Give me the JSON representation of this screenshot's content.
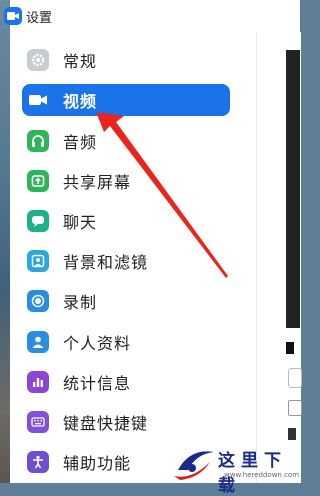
{
  "window": {
    "title": "设置"
  },
  "sidebar": {
    "items": [
      {
        "label": "常规",
        "icon": "gear-icon",
        "color": "#c9ccd1"
      },
      {
        "label": "视频",
        "icon": "video-camera-icon",
        "color": "#1a73e8",
        "selected": true
      },
      {
        "label": "音频",
        "icon": "headphones-icon",
        "color": "#2fb45a"
      },
      {
        "label": "共享屏幕",
        "icon": "share-screen-icon",
        "color": "#2fb45a"
      },
      {
        "label": "聊天",
        "icon": "chat-bubble-icon",
        "color": "#1fb08a"
      },
      {
        "label": "背景和滤镜",
        "icon": "background-portrait-icon",
        "color": "#2aa7df"
      },
      {
        "label": "录制",
        "icon": "record-icon",
        "color": "#2a8ee0"
      },
      {
        "label": "个人资料",
        "icon": "profile-icon",
        "color": "#2a8ee0"
      },
      {
        "label": "统计信息",
        "icon": "statistics-icon",
        "color": "#8e44d6"
      },
      {
        "label": "键盘快捷键",
        "icon": "keyboard-icon",
        "color": "#7d52d9"
      },
      {
        "label": "辅助功能",
        "icon": "accessibility-icon",
        "color": "#6f4fd0"
      }
    ]
  },
  "watermark": {
    "text": "这里下载",
    "url": "www.hereddown.com"
  },
  "colors": {
    "accent": "#1a73e8",
    "arrow": "#e8261e"
  }
}
